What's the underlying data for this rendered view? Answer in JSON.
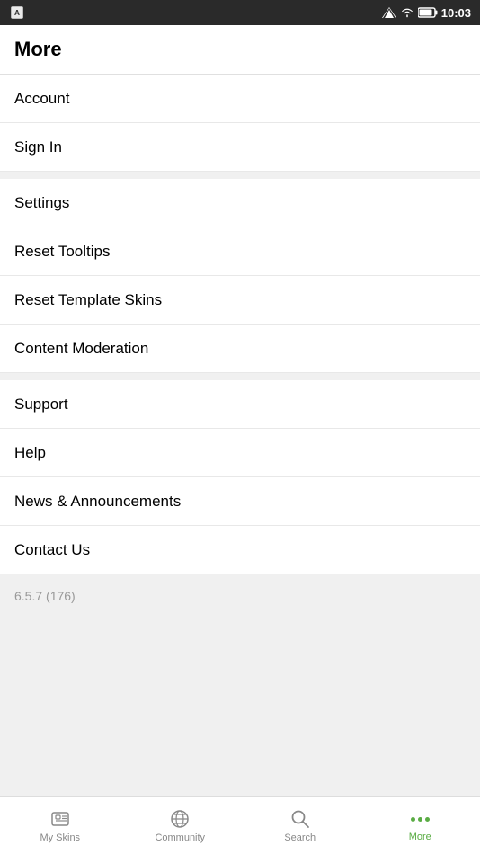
{
  "statusBar": {
    "time": "10:03"
  },
  "pageTitle": "More",
  "menuItems": [
    {
      "id": "account",
      "label": "Account",
      "hasTopDivider": false
    },
    {
      "id": "sign-in",
      "label": "Sign In",
      "hasTopDivider": false
    },
    {
      "id": "settings",
      "label": "Settings",
      "hasTopDivider": true
    },
    {
      "id": "reset-tooltips",
      "label": "Reset Tooltips",
      "hasTopDivider": false
    },
    {
      "id": "reset-template-skins",
      "label": "Reset Template Skins",
      "hasTopDivider": false
    },
    {
      "id": "content-moderation",
      "label": "Content Moderation",
      "hasTopDivider": false
    },
    {
      "id": "support",
      "label": "Support",
      "hasTopDivider": true
    },
    {
      "id": "help",
      "label": "Help",
      "hasTopDivider": false
    },
    {
      "id": "news-announcements",
      "label": "News & Announcements",
      "hasTopDivider": false
    },
    {
      "id": "contact-us",
      "label": "Contact Us",
      "hasTopDivider": false
    }
  ],
  "version": "6.5.7 (176)",
  "bottomNav": {
    "items": [
      {
        "id": "my-skins",
        "label": "My Skins",
        "active": false
      },
      {
        "id": "community",
        "label": "Community",
        "active": false
      },
      {
        "id": "search",
        "label": "Search",
        "active": false
      },
      {
        "id": "more",
        "label": "More",
        "active": true
      }
    ]
  }
}
